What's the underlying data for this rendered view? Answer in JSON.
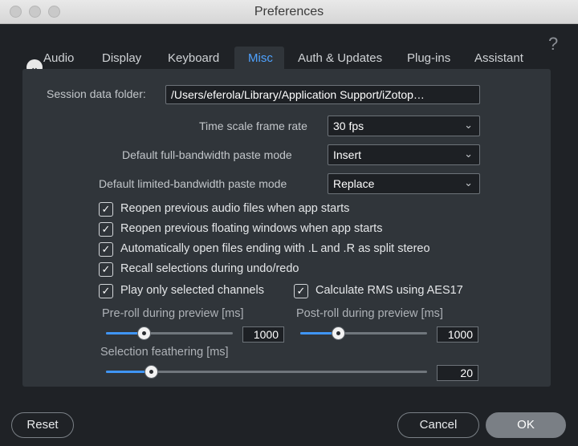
{
  "window": {
    "title": "Preferences"
  },
  "tabs": [
    {
      "label": "Audio"
    },
    {
      "label": "Display"
    },
    {
      "label": "Keyboard"
    },
    {
      "label": "Misc"
    },
    {
      "label": "Auth & Updates"
    },
    {
      "label": "Plug-ins"
    },
    {
      "label": "Assistant"
    }
  ],
  "active_tab": "Misc",
  "help": "?",
  "session": {
    "label": "Session data folder:",
    "value": "/Users/eferola/Library/Application Support/iZotop…"
  },
  "settings": {
    "frame_rate": {
      "label": "Time scale frame rate",
      "value": "30 fps"
    },
    "full_bw": {
      "label": "Default full-bandwidth paste mode",
      "value": "Insert"
    },
    "limited_bw": {
      "label": "Default limited-bandwidth paste mode",
      "value": "Replace"
    }
  },
  "checkboxes": {
    "reopen_audio": {
      "label": "Reopen previous audio files when app starts",
      "checked": true
    },
    "reopen_windows": {
      "label": "Reopen previous floating windows when app starts",
      "checked": true
    },
    "auto_open_lr": {
      "label": "Automatically open files ending with .L and .R as split stereo",
      "checked": true
    },
    "recall_selections": {
      "label": "Recall selections during undo/redo",
      "checked": true
    },
    "play_selected": {
      "label": "Play only selected channels",
      "checked": true
    },
    "rms_aes17": {
      "label": "Calculate RMS using AES17",
      "checked": true
    }
  },
  "sliders": {
    "preroll": {
      "label": "Pre-roll during preview [ms]",
      "value": "1000",
      "level": 0.3
    },
    "postroll": {
      "label": "Post-roll during preview [ms]",
      "value": "1000",
      "level": 0.3
    },
    "feathering": {
      "label": "Selection feathering [ms]",
      "value": "20",
      "level": 0.14
    }
  },
  "buttons": {
    "reset": "Reset",
    "cancel": "Cancel",
    "ok": "OK"
  },
  "check_glyph": "✓",
  "colors": {
    "accent": "#4ea2ff",
    "slider_fill": "#3f95f5",
    "background": "#1f2226",
    "panel": "#30353a"
  }
}
